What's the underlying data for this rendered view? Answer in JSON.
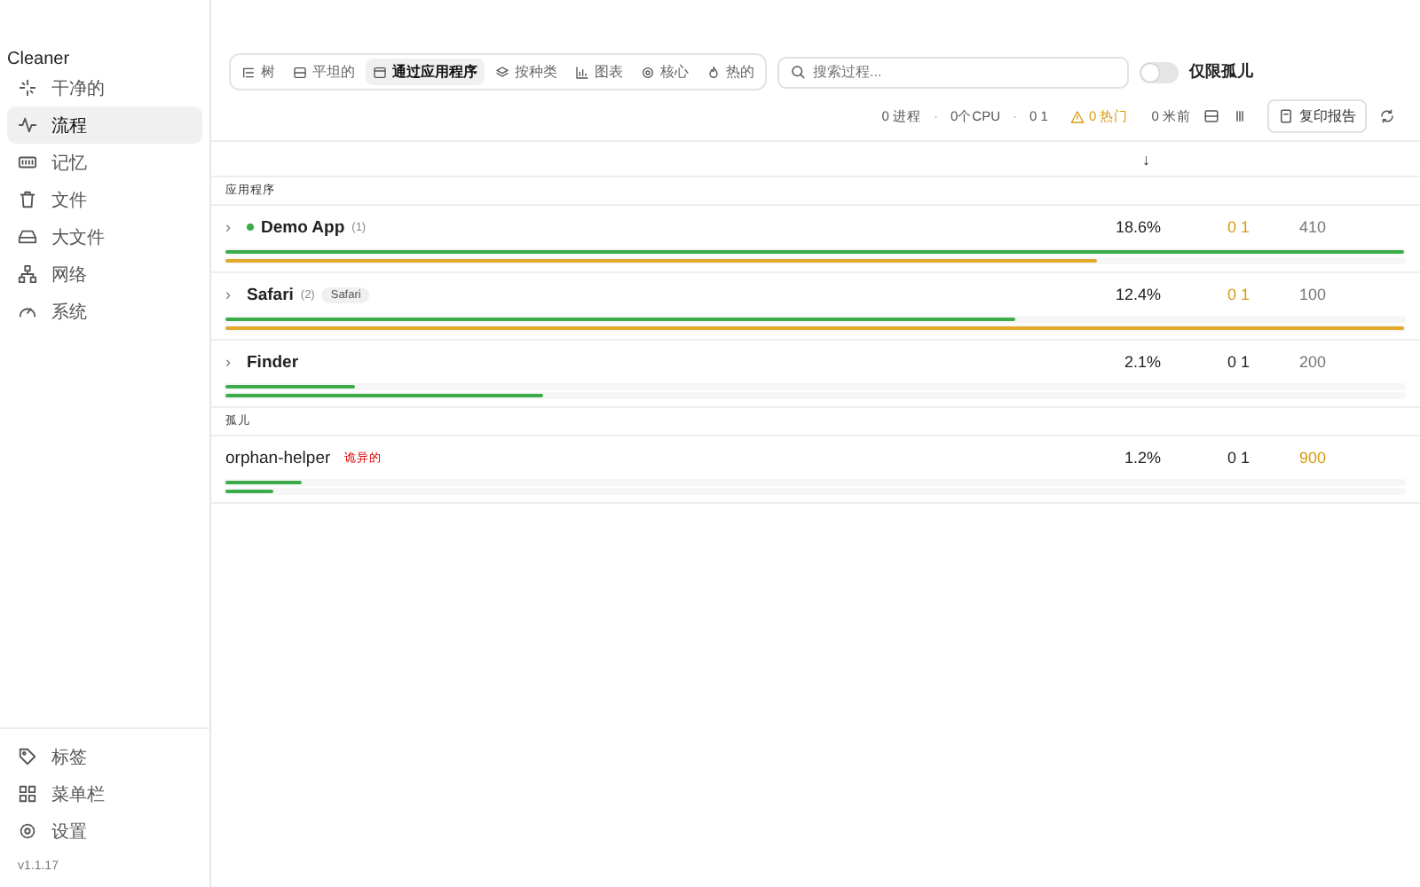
{
  "sidebar": {
    "app_name": "Cleaner",
    "items": [
      {
        "label": "干净的",
        "selected": false
      },
      {
        "label": "流程",
        "selected": true
      },
      {
        "label": "记忆",
        "selected": false
      },
      {
        "label": "文件",
        "selected": false
      },
      {
        "label": "大文件",
        "selected": false
      },
      {
        "label": "网络",
        "selected": false
      },
      {
        "label": "系统",
        "selected": false
      }
    ],
    "footer_items": [
      {
        "label": "标签"
      },
      {
        "label": "菜单栏"
      },
      {
        "label": "设置"
      }
    ],
    "version": "v1.1.17"
  },
  "toolbar": {
    "view_tabs": [
      {
        "label": "树",
        "selected": false
      },
      {
        "label": "平坦的",
        "selected": false
      },
      {
        "label": "通过应用程序",
        "selected": true
      },
      {
        "label": "按种类",
        "selected": false
      },
      {
        "label": "图表",
        "selected": false
      },
      {
        "label": "核心",
        "selected": false
      },
      {
        "label": "热的",
        "selected": false
      }
    ],
    "search": {
      "placeholder": "搜索过程..."
    },
    "orphans_only": {
      "label": "仅限孤儿",
      "on": false
    }
  },
  "stats": {
    "processes": "0 进程",
    "separator_1": "·",
    "cpus": "0个CPU",
    "separator_2": "·",
    "load": "0 1",
    "hot": "0 热门",
    "updated": "0 米前",
    "copy_button": "复印报告"
  },
  "table": {
    "sort_indicator": "↓",
    "groups": [
      {
        "label": "应用程序",
        "rows": [
          {
            "name": "Demo App",
            "chevron": "›",
            "running": true,
            "count": "(1)",
            "cpu": "18.6%",
            "threads": "0 1",
            "threads_warn": true,
            "memory": "410",
            "memory_warn": false,
            "bars": [
              {
                "color": "#3cac48",
                "level": 1.0
              },
              {
                "color": "#e2a82a",
                "level": 0.74
              }
            ]
          },
          {
            "name": "Safari",
            "chevron": "›",
            "running": false,
            "count": "(2)",
            "tag": "Safari",
            "cpu": "12.4%",
            "threads": "0 1",
            "threads_warn": true,
            "memory": "100",
            "memory_warn": false,
            "bars": [
              {
                "color": "#3cac48",
                "level": 0.67
              },
              {
                "color": "#e2a82a",
                "level": 1.0
              }
            ]
          },
          {
            "name": "Finder",
            "chevron": "›",
            "running": false,
            "cpu": "2.1%",
            "threads": "0 1",
            "threads_warn": false,
            "memory": "200",
            "memory_warn": false,
            "bars": [
              {
                "color": "#3cac48",
                "level": 0.11
              },
              {
                "color": "#3cac48",
                "level": 0.27
              }
            ]
          }
        ]
      },
      {
        "label": "孤儿",
        "rows": [
          {
            "name": "orphan-helper",
            "running": false,
            "badge": "诡异的",
            "cpu": "1.2%",
            "threads": "0 1",
            "threads_warn": false,
            "memory": "900",
            "memory_warn": true,
            "bars": [
              {
                "color": "#3cac48",
                "level": 0.065
              },
              {
                "color": "#3cac48",
                "level": 0.04
              }
            ]
          }
        ]
      }
    ]
  }
}
